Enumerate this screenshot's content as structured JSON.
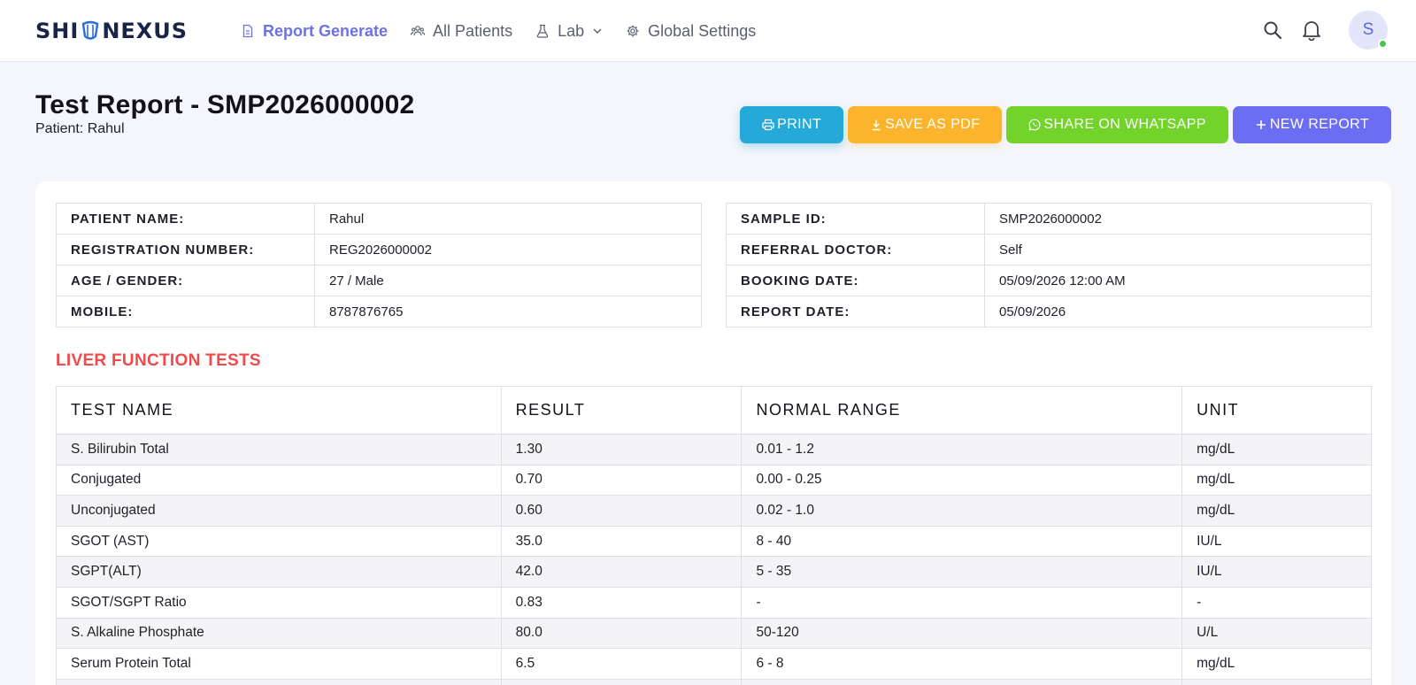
{
  "brand": {
    "name_left": "SHI",
    "name_right": "NEXUS"
  },
  "nav": {
    "items": [
      {
        "label": "Report Generate",
        "icon": "document-icon",
        "active": true
      },
      {
        "label": "All Patients",
        "icon": "users-icon",
        "active": false
      },
      {
        "label": "Lab",
        "icon": "flask-icon",
        "active": false,
        "has_dropdown": true
      },
      {
        "label": "Global Settings",
        "icon": "gear-icon",
        "active": false
      }
    ]
  },
  "user": {
    "avatar_initial": "S",
    "status_color": "#4cc44c"
  },
  "page": {
    "title": "Test Report - SMP2026000002",
    "subtitle": "Patient: Rahul"
  },
  "actions": {
    "print": "PRINT",
    "save_pdf": "SAVE AS PDF",
    "whatsapp": "SHARE ON WHATSAPP",
    "new_report": "NEW REPORT"
  },
  "patient_info": [
    {
      "label": "PATIENT NAME:",
      "value": "Rahul"
    },
    {
      "label": "REGISTRATION NUMBER:",
      "value": "REG2026000002"
    },
    {
      "label": "AGE / GENDER:",
      "value": "27 / Male"
    },
    {
      "label": "MOBILE:",
      "value": "8787876765"
    }
  ],
  "sample_info": [
    {
      "label": "SAMPLE ID:",
      "value": "SMP2026000002"
    },
    {
      "label": "REFERRAL DOCTOR:",
      "value": "Self"
    },
    {
      "label": "BOOKING DATE:",
      "value": "05/09/2026 12:00 AM"
    },
    {
      "label": "REPORT DATE:",
      "value": "05/09/2026"
    }
  ],
  "section": {
    "title": "LIVER FUNCTION TESTS"
  },
  "results": {
    "columns": [
      "TEST NAME",
      "RESULT",
      "NORMAL RANGE",
      "UNIT"
    ],
    "rows": [
      [
        "S. Bilirubin Total",
        "1.30",
        "0.01 - 1.2",
        "mg/dL"
      ],
      [
        "Conjugated",
        "0.70",
        "0.00 - 0.25",
        "mg/dL"
      ],
      [
        "Unconjugated",
        "0.60",
        "0.02 - 1.0",
        "mg/dL"
      ],
      [
        "SGOT (AST)",
        "35.0",
        "8 - 40",
        "IU/L"
      ],
      [
        "SGPT(ALT)",
        "42.0",
        "5 - 35",
        "IU/L"
      ],
      [
        "SGOT/SGPT Ratio",
        "0.83",
        "-",
        "-"
      ],
      [
        "S. Alkaline Phosphate",
        "80.0",
        "50-120",
        "U/L"
      ],
      [
        "Serum Protein Total",
        "6.5",
        "6 - 8",
        "mg/dL"
      ]
    ]
  },
  "colors": {
    "accent": "#6b72e8",
    "print": "#25a9d9",
    "pdf": "#fbb42c",
    "whatsapp": "#72d42a",
    "new_report": "#6b6df2",
    "section_title": "#f04a4a"
  }
}
